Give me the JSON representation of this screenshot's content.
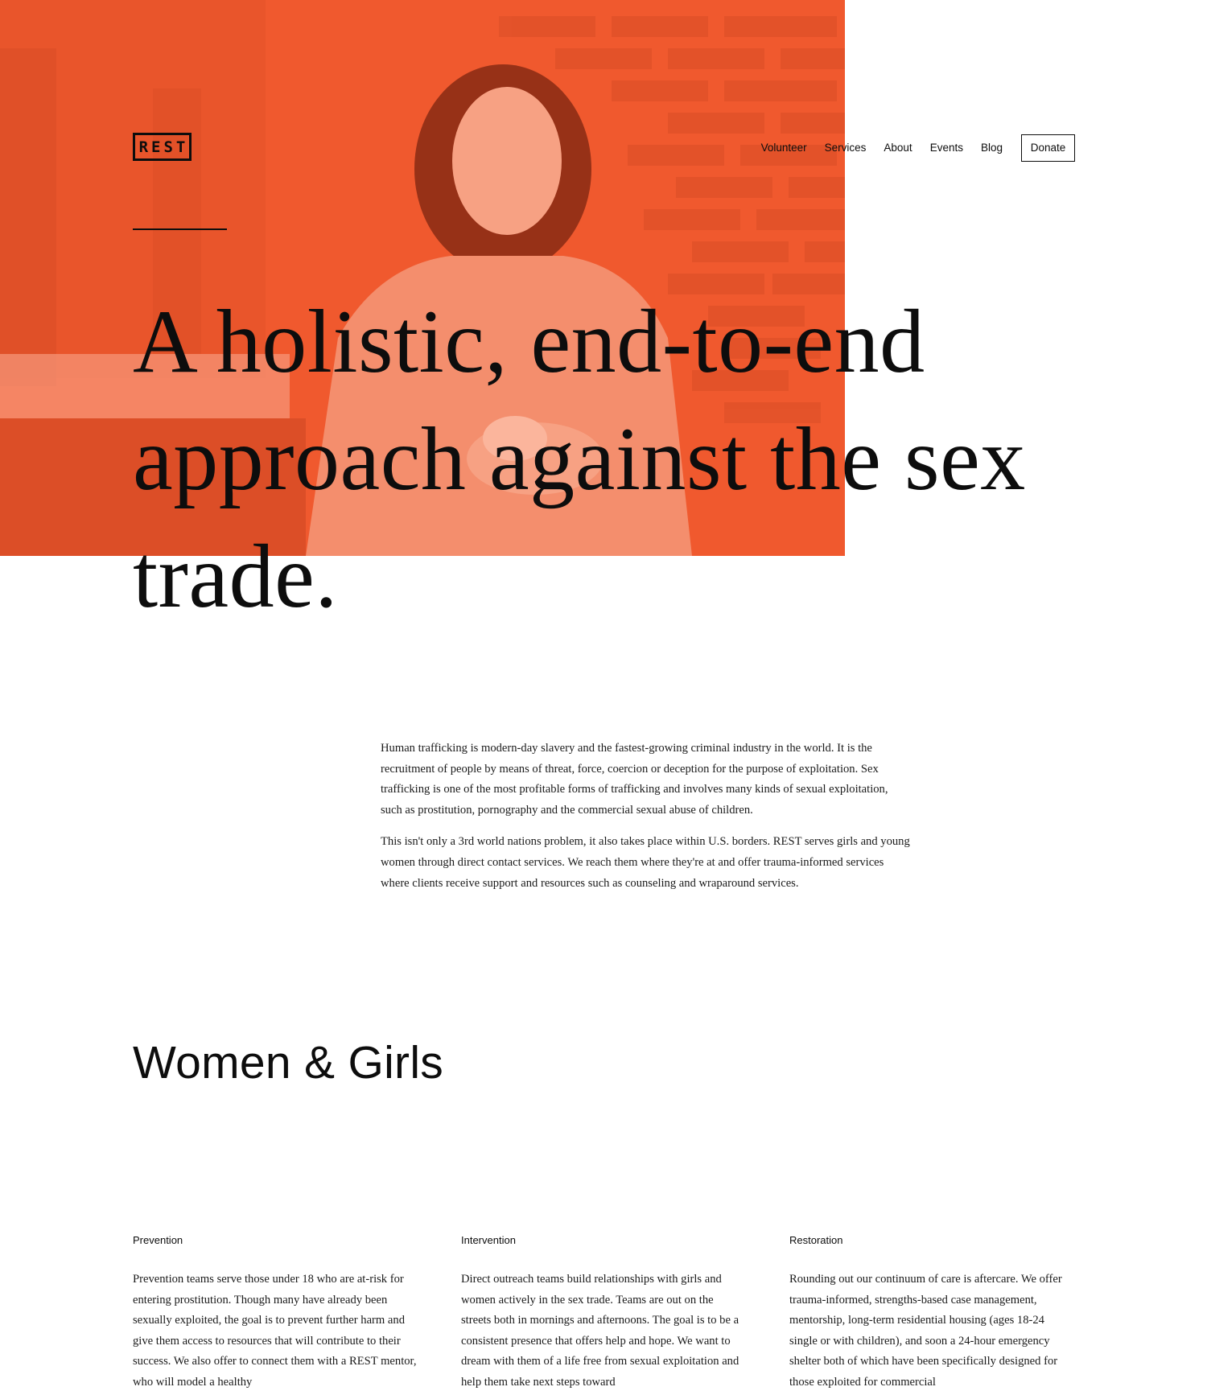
{
  "brand": {
    "logo_text": "REST",
    "accent_color": "#f0592e"
  },
  "nav": {
    "links": [
      "Volunteer",
      "Services",
      "About",
      "Events",
      "Blog"
    ],
    "donate_label": "Donate"
  },
  "hero": {
    "headline": "A holistic, end-to-end approach against the sex trade."
  },
  "intro": {
    "paragraphs": [
      "Human trafficking is modern-day slavery and the fastest-growing criminal industry in the world. It is the recruitment of people by means of threat, force, coercion or deception for the purpose of exploitation. Sex trafficking is one of the most profitable forms of trafficking and involves many kinds of sexual exploitation, such as prostitution, pornography and the commercial sexual abuse of children.",
      "This isn't only a 3rd world nations problem, it also takes place within U.S. borders. REST serves girls and young women through direct contact services. We reach them where they're at and offer trauma-informed services where clients receive support and resources such as counseling and wraparound services."
    ]
  },
  "section": {
    "title": "Women & Girls"
  },
  "columns": [
    {
      "title": "Prevention",
      "body": "Prevention teams serve those under 18 who are at-risk for entering prostitution. Though many have already been sexually exploited, the goal is to prevent further harm and give them access to resources that will contribute to their success. We also offer to connect them with a REST mentor, who will model a healthy"
    },
    {
      "title": "Intervention",
      "body": "Direct outreach teams build relationships with girls and women actively in the sex trade. Teams are out on the streets both in mornings and afternoons. The goal is to be a consistent presence that offers help and hope. We want to dream with them of a life free from sexual exploitation and help them take next steps toward"
    },
    {
      "title": "Restoration",
      "body": "Rounding out our continuum of care is aftercare. We offer trauma-informed, strengths-based case management, mentorship, long-term residential housing (ages 18-24 single or with children), and soon a 24-hour emergency shelter both of which have been specifically designed for those exploited for commercial"
    }
  ]
}
